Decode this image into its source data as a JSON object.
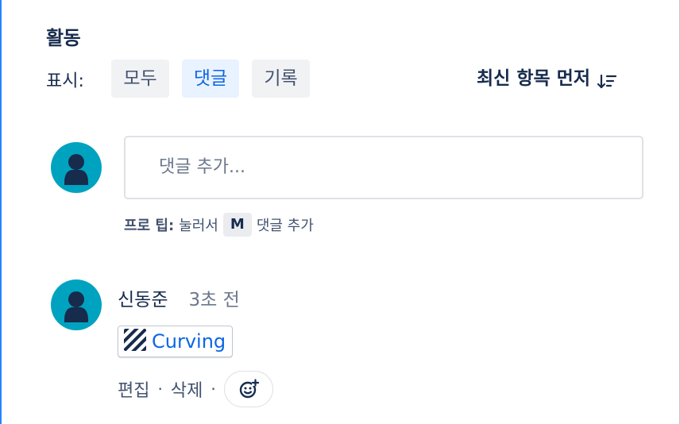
{
  "activity": {
    "title": "활동",
    "show_label": "표시:",
    "filters": [
      {
        "label": "모두",
        "active": false
      },
      {
        "label": "댓글",
        "active": true
      },
      {
        "label": "기록",
        "active": false
      }
    ],
    "sort_label": "최신 항목 먼저"
  },
  "composer": {
    "avatar_icon": "user-avatar-icon",
    "placeholder": "댓글 추가...",
    "tip_strong": "프로 팁:",
    "tip_pre": "눌러서",
    "tip_key": "M",
    "tip_post": "댓글 추가"
  },
  "comments": [
    {
      "author": "신동준",
      "time": "3초 전",
      "attachment_label": "Curving",
      "attachment_icon": "striped-issue-icon",
      "actions": {
        "edit": "편집",
        "separator": "·",
        "delete": "삭제"
      },
      "reaction_icon": "add-reaction-icon"
    }
  ],
  "colors": {
    "accent": "#0c66e4",
    "avatar_bg": "#00a3bf",
    "active_filter_bg": "#e9f2ff",
    "filter_bg": "#f1f2f4",
    "frame_left_border": "#2684ff"
  }
}
